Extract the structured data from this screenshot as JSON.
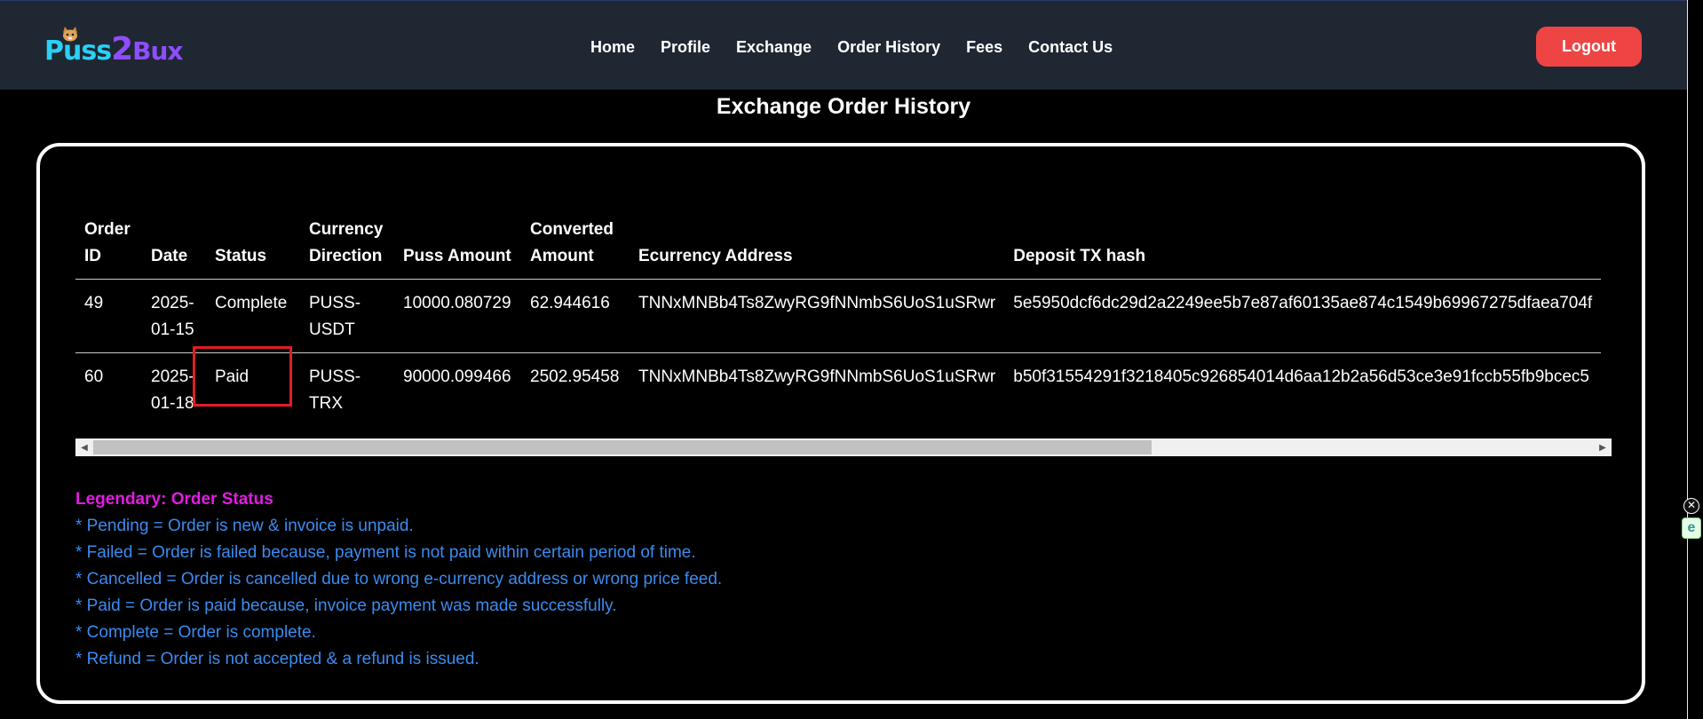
{
  "brand": {
    "logo_part1": "Puss",
    "logo_part2": "2",
    "logo_part3": "Bux"
  },
  "nav": {
    "links": [
      "Home",
      "Profile",
      "Exchange",
      "Order History",
      "Fees",
      "Contact Us"
    ],
    "logout_label": "Logout"
  },
  "page": {
    "title": "Exchange Order History"
  },
  "table": {
    "headers": {
      "order_id": "Order ID",
      "date": "Date",
      "status": "Status",
      "currency_direction": "Currency Direction",
      "puss_amount": "Puss Amount",
      "converted_amount": "Converted Amount",
      "ecurrency_address": "Ecurrency Address",
      "deposit_tx_hash": "Deposit TX hash"
    },
    "rows": [
      {
        "order_id": "49",
        "date": "2025-01-15",
        "status": "Complete",
        "currency_direction": "PUSS-USDT",
        "puss_amount": "10000.080729",
        "converted_amount": "62.944616",
        "ecurrency_address": "TNNxMNBb4Ts8ZwyRG9fNNmbS6UoS1uSRwr",
        "deposit_tx_hash": "5e5950dcf6dc29d2a2249ee5b7e87af60135ae874c1549b69967275dfaea704f"
      },
      {
        "order_id": "60",
        "date": "2025-01-18",
        "status": "Paid",
        "currency_direction": "PUSS-TRX",
        "puss_amount": "90000.099466",
        "converted_amount": "2502.95458",
        "ecurrency_address": "TNNxMNBb4Ts8ZwyRG9fNNmbS6UoS1uSRwr",
        "deposit_tx_hash": "b50f31554291f3218405c926854014d6aa12b2a56d53ce3e91fccb55fb9bcec5"
      }
    ]
  },
  "legend": {
    "title": "Legendary: Order Status",
    "items": [
      "* Pending = Order is new & invoice is unpaid.",
      "* Failed = Order is failed because, payment is not paid within certain period of time.",
      "* Cancelled = Order is cancelled due to wrong e-currency address or wrong price feed.",
      "* Paid = Order is paid because, invoice payment was made successfully.",
      "* Complete = Order is complete.",
      "* Refund = Order is not accepted & a refund is issued."
    ]
  },
  "colors": {
    "navbar_bg": "#1f2733",
    "logout_bg": "#ef4444",
    "legend_title": "#e31ce3",
    "legend_text": "#3b8cf0",
    "highlight": "#e11d24"
  },
  "side_widget": {
    "close_icon": "close-icon",
    "e_icon_glyph": "e"
  }
}
